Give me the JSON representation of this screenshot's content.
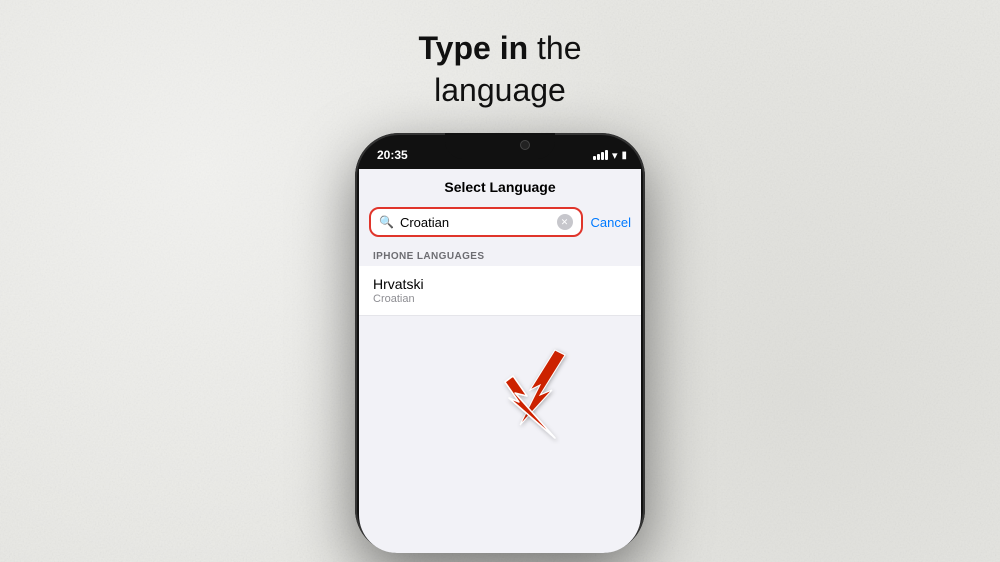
{
  "heading": {
    "part1": "Type in",
    "part2": " the",
    "line2": "language"
  },
  "status_bar": {
    "time": "20:35"
  },
  "modal": {
    "title": "Select Language",
    "search_value": "Croatian",
    "cancel_label": "Cancel",
    "section_header": "IPHONE LANGUAGES",
    "result_title": "Hrvatski",
    "result_subtitle": "Croatian"
  }
}
